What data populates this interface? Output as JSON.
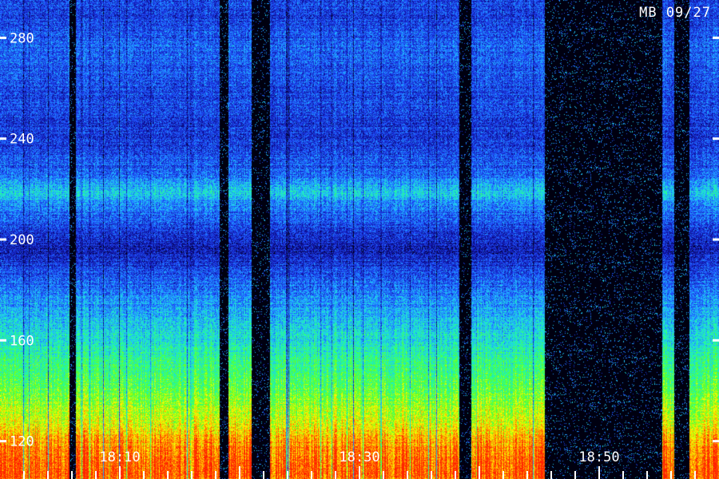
{
  "chart_data": {
    "type": "heatmap",
    "title": "",
    "xlabel": "",
    "ylabel": "",
    "corner_label": "MB 09/27",
    "y_ticks": [
      {
        "value": 280,
        "label": "280"
      },
      {
        "value": 240,
        "label": "240"
      },
      {
        "value": 200,
        "label": "200"
      },
      {
        "value": 160,
        "label": "160"
      },
      {
        "value": 120,
        "label": "120"
      }
    ],
    "x_ticks": [
      {
        "value": "18:10",
        "label": "18:10"
      },
      {
        "value": "18:30",
        "label": "18:30"
      },
      {
        "value": "18:50",
        "label": "18:50"
      }
    ],
    "ylim": [
      105,
      295
    ],
    "xlim": [
      "18:00",
      "18:60"
    ],
    "colormap": [
      "#000020",
      "#1010a0",
      "#2050ff",
      "#20c0ff",
      "#20ffa0",
      "#60ff20",
      "#ffff00",
      "#ff9000",
      "#ff2000"
    ],
    "intensity_by_frequency": [
      {
        "f": 110,
        "level": 0.97
      },
      {
        "f": 118,
        "level": 0.92
      },
      {
        "f": 128,
        "level": 0.75
      },
      {
        "f": 140,
        "level": 0.62
      },
      {
        "f": 155,
        "level": 0.5
      },
      {
        "f": 170,
        "level": 0.38
      },
      {
        "f": 185,
        "level": 0.26
      },
      {
        "f": 196,
        "level": 0.15
      },
      {
        "f": 205,
        "level": 0.22
      },
      {
        "f": 212,
        "level": 0.3
      },
      {
        "f": 219,
        "level": 0.42
      },
      {
        "f": 226,
        "level": 0.28
      },
      {
        "f": 240,
        "level": 0.2
      },
      {
        "f": 260,
        "level": 0.24
      },
      {
        "f": 275,
        "level": 0.28
      },
      {
        "f": 290,
        "level": 0.22
      }
    ],
    "dropouts": [
      {
        "start": "18:05.8",
        "end": "18:06.3"
      },
      {
        "start": "18:18.3",
        "end": "18:19.0"
      },
      {
        "start": "18:21.0",
        "end": "18:22.5"
      },
      {
        "start": "18:38.3",
        "end": "18:39.3"
      },
      {
        "start": "18:45.4",
        "end": "18:55.2"
      },
      {
        "start": "18:56.2",
        "end": "18:57.5"
      }
    ]
  }
}
